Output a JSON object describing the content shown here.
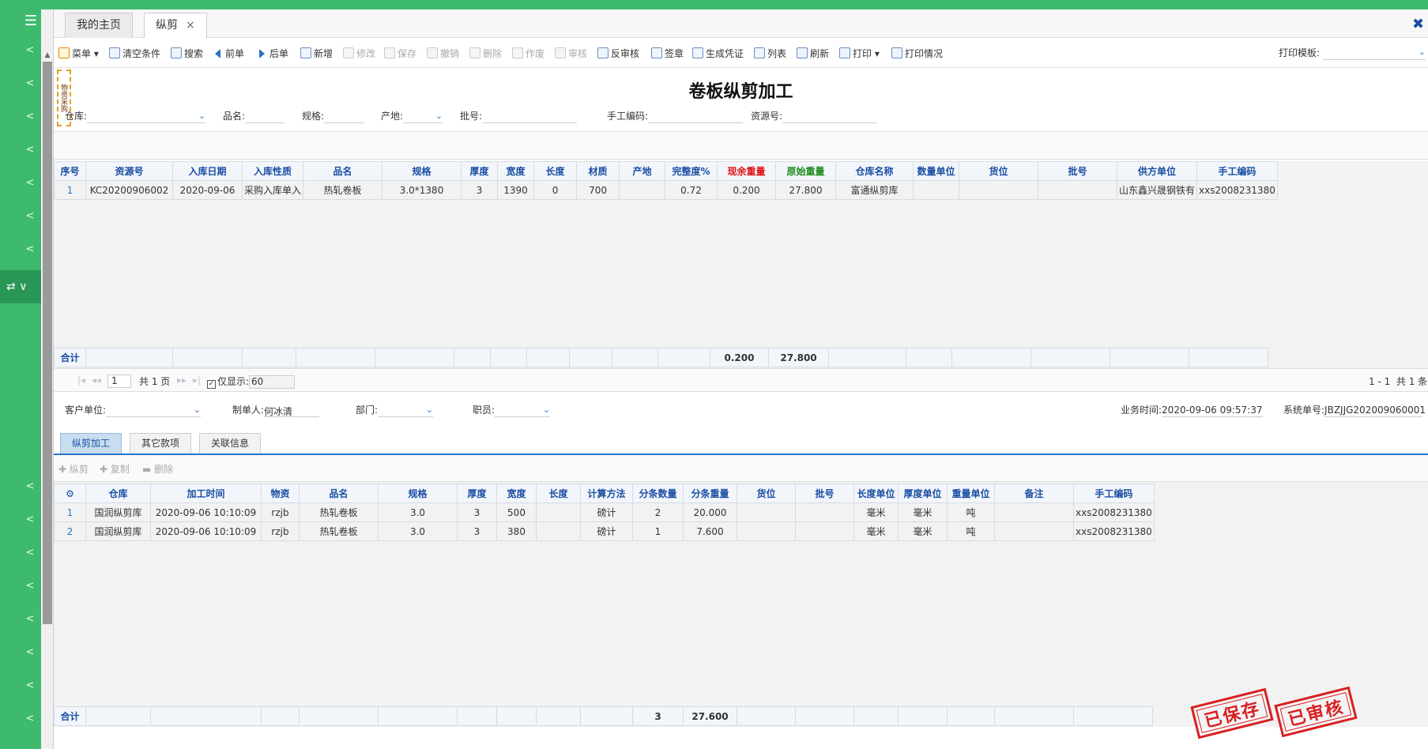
{
  "sidebar": {
    "logo_icon": "menu-list-icon",
    "active_icon": "switch-icon",
    "active_label": "∨",
    "chevron": "<"
  },
  "tabs": [
    {
      "label": "我的主页"
    },
    {
      "label": "纵剪",
      "close": "×"
    }
  ],
  "toolbar": {
    "menu": "菜单",
    "clear": "清空条件",
    "search": "搜索",
    "prev": "前单",
    "next": "后单",
    "new": "新增",
    "edit": "修改",
    "save": "保存",
    "undo": "撤销",
    "delete": "删除",
    "void": "作废",
    "audit": "审核",
    "unaudit": "反审核",
    "sign": "签章",
    "voucher": "生成凭证",
    "list": "列表",
    "refresh": "刷新",
    "print": "打印",
    "print_status": "打印情况",
    "print_template_label": "打印模板:"
  },
  "header": {
    "title": "卷板纵剪加工",
    "stamp_text": "物资采购",
    "warehouse_label": "仓库:",
    "pinming_label": "品名:",
    "spec_label": "规格:",
    "origin_label": "产地:",
    "batch_label": "批号:",
    "manual_code_label": "手工编码:",
    "resource_label": "资源号:"
  },
  "grid1": {
    "columns": [
      "序号",
      "资源号",
      "入库日期",
      "入库性质",
      "品名",
      "规格",
      "厚度",
      "宽度",
      "长度",
      "材质",
      "产地",
      "完整度%",
      "现余重量",
      "原始重量",
      "仓库名称",
      "数量单位",
      "货位",
      "批号",
      "供方单位",
      "手工编码"
    ],
    "rows": [
      [
        "1",
        "KC20200906002",
        "2020-09-06",
        "采购入库单入",
        "热轧卷板",
        "3.0*1380",
        "3",
        "1390",
        "0",
        "700",
        "",
        "0.72",
        "0.200",
        "27.800",
        "富通纵剪库",
        "",
        "",
        "",
        "山东鑫兴晟钢铁有",
        "xxs2008231380"
      ]
    ],
    "sum_label": "合计",
    "sum_remaining": "0.200",
    "sum_original": "27.800"
  },
  "pager": {
    "page": "1",
    "total_pages": "共 1 页",
    "only_show": "仅显示:",
    "show_count": "60",
    "range": "1 - 1",
    "total": "共 1 条"
  },
  "info2": {
    "customer_label": "客户单位:",
    "maker_label": "制单人:",
    "maker_value": "何冰清",
    "dept_label": "部门:",
    "staff_label": "职员:",
    "biz_time_label": "业务时间:",
    "biz_time_value": "2020-09-06 09:57:37",
    "sys_no_label": "系统单号:",
    "sys_no_value": "JBZJJG202009060001"
  },
  "subtabs": [
    "纵剪加工",
    "其它款项",
    "关联信息"
  ],
  "subtools": {
    "slit": "纵剪",
    "copy": "复制",
    "delete": "删除"
  },
  "grid2": {
    "columns": [
      "",
      "仓库",
      "加工时间",
      "物资",
      "品名",
      "规格",
      "厚度",
      "宽度",
      "长度",
      "计算方法",
      "分条数量",
      "分条重量",
      "货位",
      "批号",
      "长度单位",
      "厚度单位",
      "重量单位",
      "备注",
      "手工编码"
    ],
    "rows": [
      [
        "1",
        "国润纵剪库",
        "2020-09-06 10:10:09",
        "rzjb",
        "热轧卷板",
        "3.0",
        "3",
        "500",
        "",
        "磅计",
        "2",
        "20.000",
        "",
        "",
        "毫米",
        "毫米",
        "吨",
        "",
        "xxs2008231380"
      ],
      [
        "2",
        "国润纵剪库",
        "2020-09-06 10:10:09",
        "rzjb",
        "热轧卷板",
        "3.0",
        "3",
        "380",
        "",
        "磅计",
        "1",
        "7.600",
        "",
        "",
        "毫米",
        "毫米",
        "吨",
        "",
        "xxs2008231380"
      ]
    ],
    "sum_label": "合计",
    "sum_count": "3",
    "sum_weight": "27.600"
  },
  "seals": {
    "saved": "已保存",
    "audited": "已审核"
  },
  "colors": {
    "sidebar": "#3dba6e",
    "accent": "#1a4ea3",
    "seal": "#d82020"
  }
}
